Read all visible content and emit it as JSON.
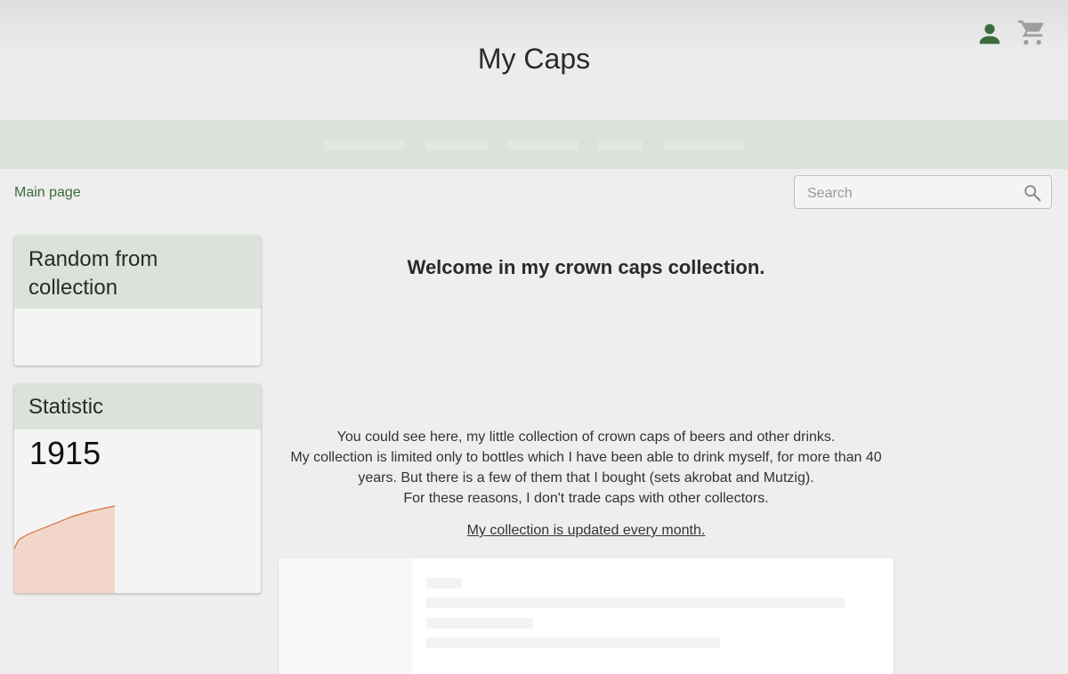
{
  "header": {
    "title": "My Caps",
    "icons": {
      "user": "user-icon",
      "cart": "cart-icon"
    },
    "accent_color": "#3b6b3b"
  },
  "breadcrumb": {
    "label": "Main page"
  },
  "search": {
    "placeholder": "Search",
    "value": ""
  },
  "sidebar": {
    "random_card": {
      "title": "Random from collection"
    },
    "statistic_card": {
      "title": "Statistic",
      "count": "1915"
    }
  },
  "main": {
    "welcome": "Welcome in my crown caps collection.",
    "intro_lines": [
      "You could see here, my little collection of crown caps of beers and other drinks.",
      "My collection is limited only to bottles which I have been able to drink myself, for more than 40 years. But there is a few of them that I bought (sets akrobat and Mutzig).",
      "For these reasons, I don't trade caps with other collectors."
    ],
    "update_note": "My collection is updated every month."
  }
}
